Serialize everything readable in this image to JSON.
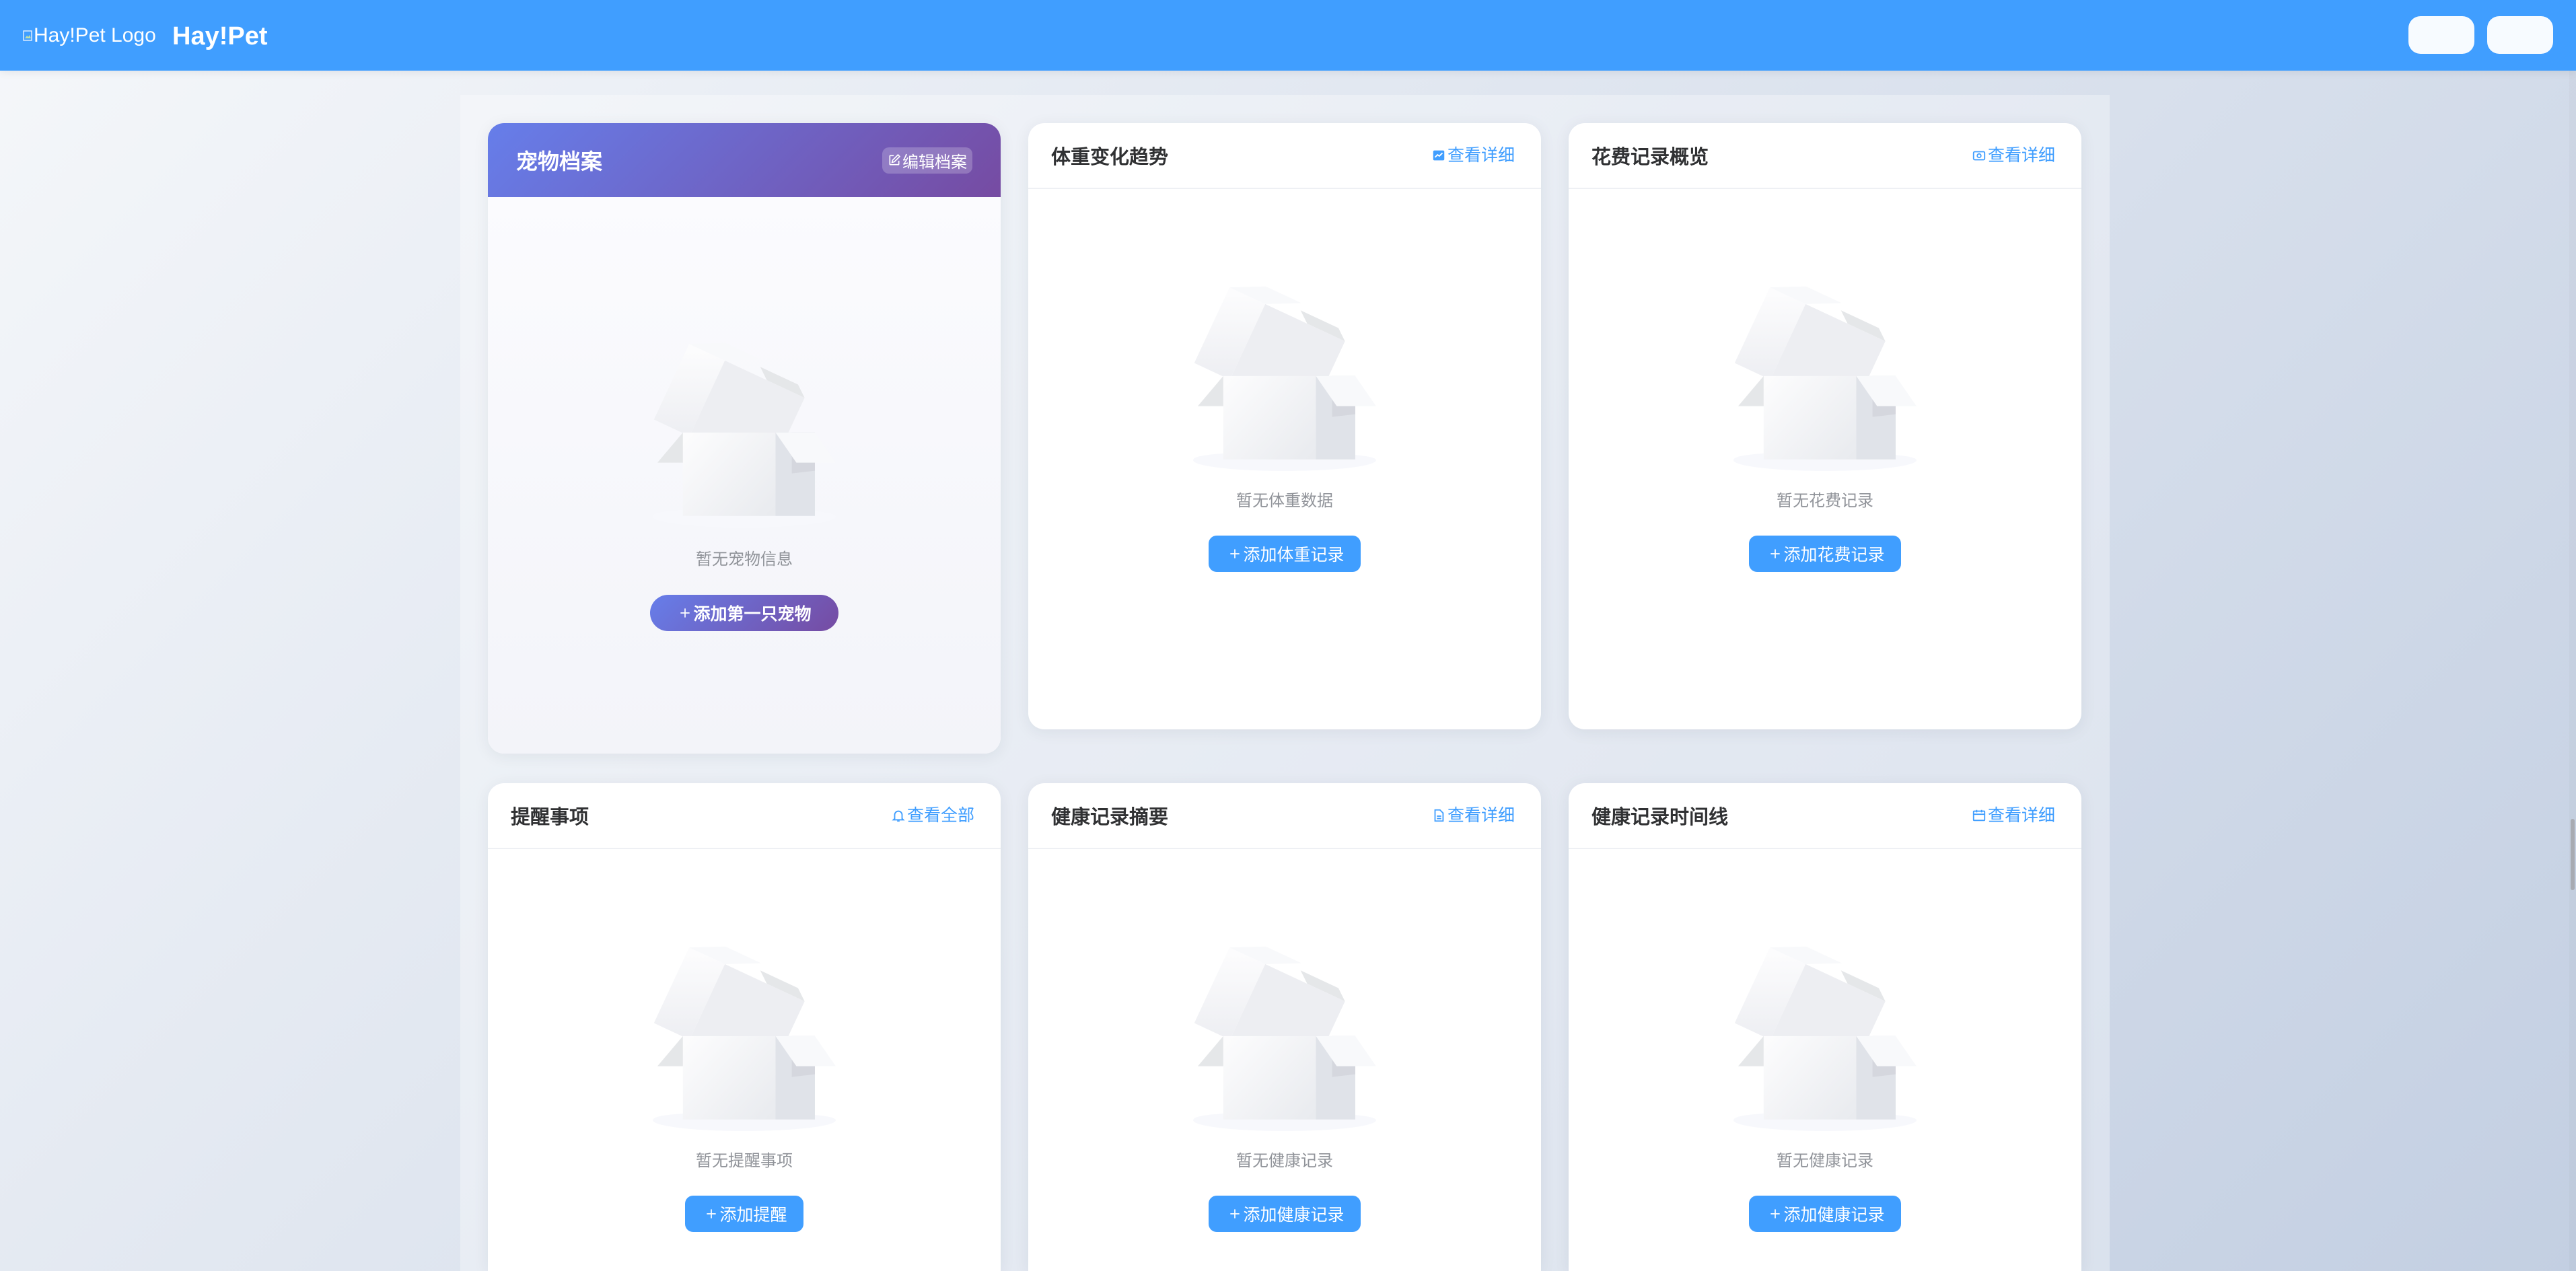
{
  "header": {
    "logo_icon": "broken-image-icon",
    "logo_alt": "Hay!Pet Logo",
    "brand": "Hay!Pet"
  },
  "colors": {
    "header_bg": "#409eff",
    "accent": "#409eff",
    "pet_gradient_start": "#667eea",
    "pet_gradient_end": "#764ba2",
    "muted_text": "#909399",
    "title_text": "#303133"
  },
  "pet_card": {
    "title": "宠物档案",
    "edit_icon": "edit-icon",
    "edit_label": "编辑档案",
    "empty_icon": "empty-box-illustration",
    "empty_text": "暂无宠物信息",
    "add_icon": "plus-icon",
    "add_label": "添加第一只宠物"
  },
  "cards": [
    {
      "title": "体重变化趋势",
      "link_icon": "trend-charts-icon",
      "link_label": "查看详细",
      "empty_text": "暂无体重数据",
      "add_icon": "plus-icon",
      "add_label": "添加体重记录"
    },
    {
      "title": "花费记录概览",
      "link_icon": "money-icon",
      "link_label": "查看详细",
      "empty_text": "暂无花费记录",
      "add_icon": "plus-icon",
      "add_label": "添加花费记录"
    },
    {
      "title": "提醒事项",
      "link_icon": "bell-icon",
      "link_label": "查看全部",
      "empty_text": "暂无提醒事项",
      "add_icon": "plus-icon",
      "add_label": "添加提醒"
    },
    {
      "title": "健康记录摘要",
      "link_icon": "document-icon",
      "link_label": "查看详细",
      "empty_text": "暂无健康记录",
      "add_icon": "plus-icon",
      "add_label": "添加健康记录"
    },
    {
      "title": "健康记录时间线",
      "link_icon": "calendar-icon",
      "link_label": "查看详细",
      "empty_text": "暂无健康记录",
      "add_icon": "plus-icon",
      "add_label": "添加健康记录"
    }
  ]
}
